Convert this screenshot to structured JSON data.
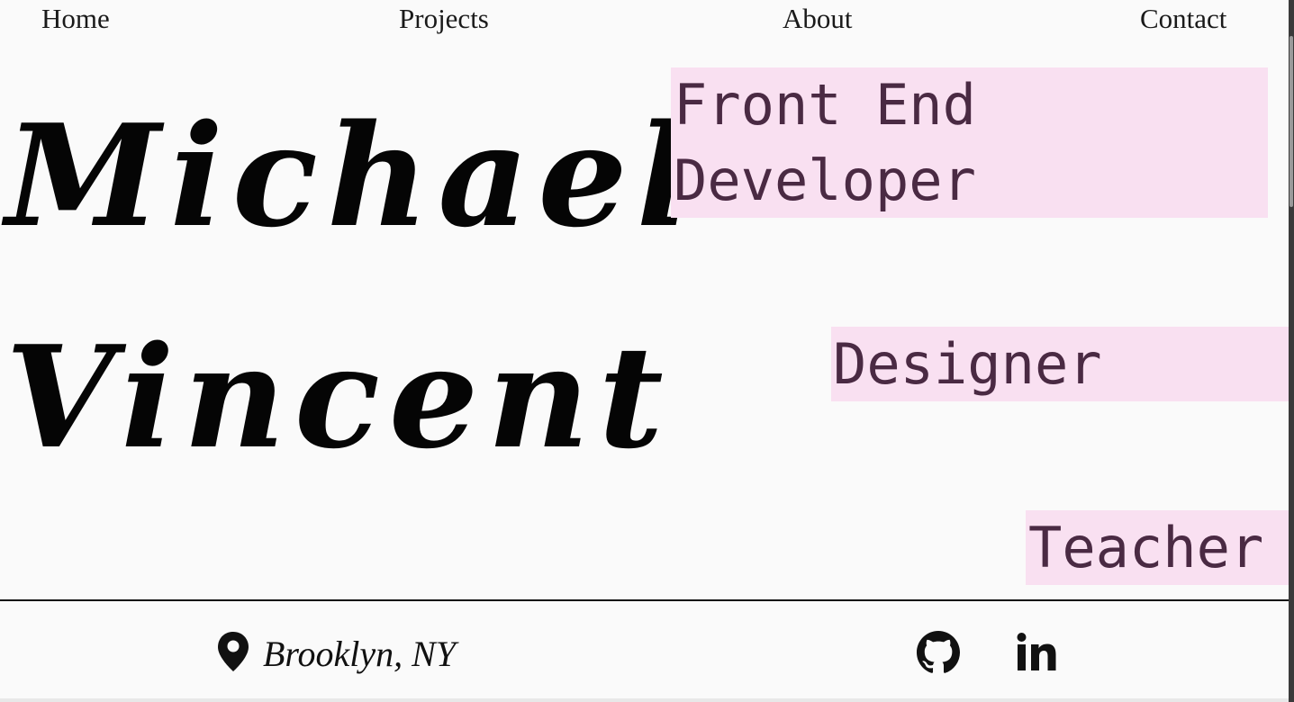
{
  "nav": {
    "home": "Home",
    "projects": "Projects",
    "about": "About",
    "contact": "Contact"
  },
  "hero": {
    "first_name": "Michael",
    "last_name": "Vincent",
    "roles": [
      "Front End Developer",
      "Designer",
      "Teacher"
    ]
  },
  "footer": {
    "location": "Brooklyn, NY",
    "location_icon": "map-pin-icon",
    "social_icons": [
      "github-icon",
      "linkedin-icon"
    ]
  },
  "colors": {
    "background": "#fafafa",
    "role_highlight": "#f9e0f1",
    "role_text": "#4a2a43",
    "text": "#111111"
  }
}
